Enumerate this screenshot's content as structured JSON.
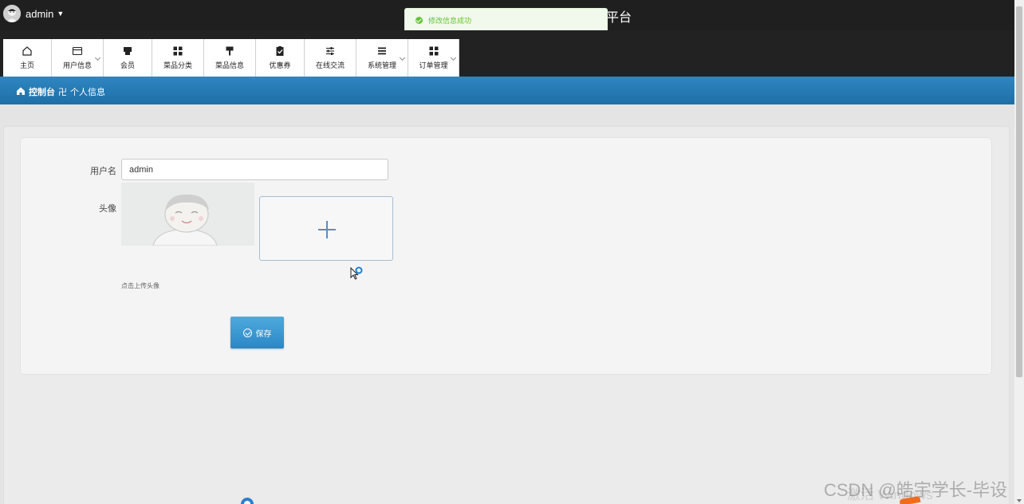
{
  "topbar": {
    "username": "admin",
    "site_title_partial": "平台"
  },
  "toast": {
    "message": "修改信息成功",
    "color": "#67c23a"
  },
  "nav": {
    "items": [
      {
        "label": "主页",
        "icon": "home-icon",
        "has_dropdown": false
      },
      {
        "label": "用户信息",
        "icon": "card-icon",
        "has_dropdown": true
      },
      {
        "label": "会员",
        "icon": "store-icon",
        "has_dropdown": false
      },
      {
        "label": "菜品分类",
        "icon": "grid-icon",
        "has_dropdown": false
      },
      {
        "label": "菜品信息",
        "icon": "brush-icon",
        "has_dropdown": false
      },
      {
        "label": "优惠券",
        "icon": "clipboard-check-icon",
        "has_dropdown": false
      },
      {
        "label": "在线交流",
        "icon": "sliders-icon",
        "has_dropdown": false
      },
      {
        "label": "系统管理",
        "icon": "list-icon",
        "has_dropdown": true
      },
      {
        "label": "订单管理",
        "icon": "grid-icon",
        "has_dropdown": true
      }
    ]
  },
  "breadcrumb": {
    "home": "控制台",
    "current": "个人信息"
  },
  "form": {
    "username_label": "用户名",
    "username_value": "admin",
    "avatar_label": "头像",
    "upload_hint": "点击上传头像",
    "save_label": "保存"
  },
  "overlay": {
    "watermark": "CSDN @皓宇学长-毕设",
    "activate_text": "激活 Windows"
  },
  "colors": {
    "nav_bg": "#222222",
    "crumb_bg": "#1f6fa6",
    "button_bg": "#2b88c6"
  }
}
